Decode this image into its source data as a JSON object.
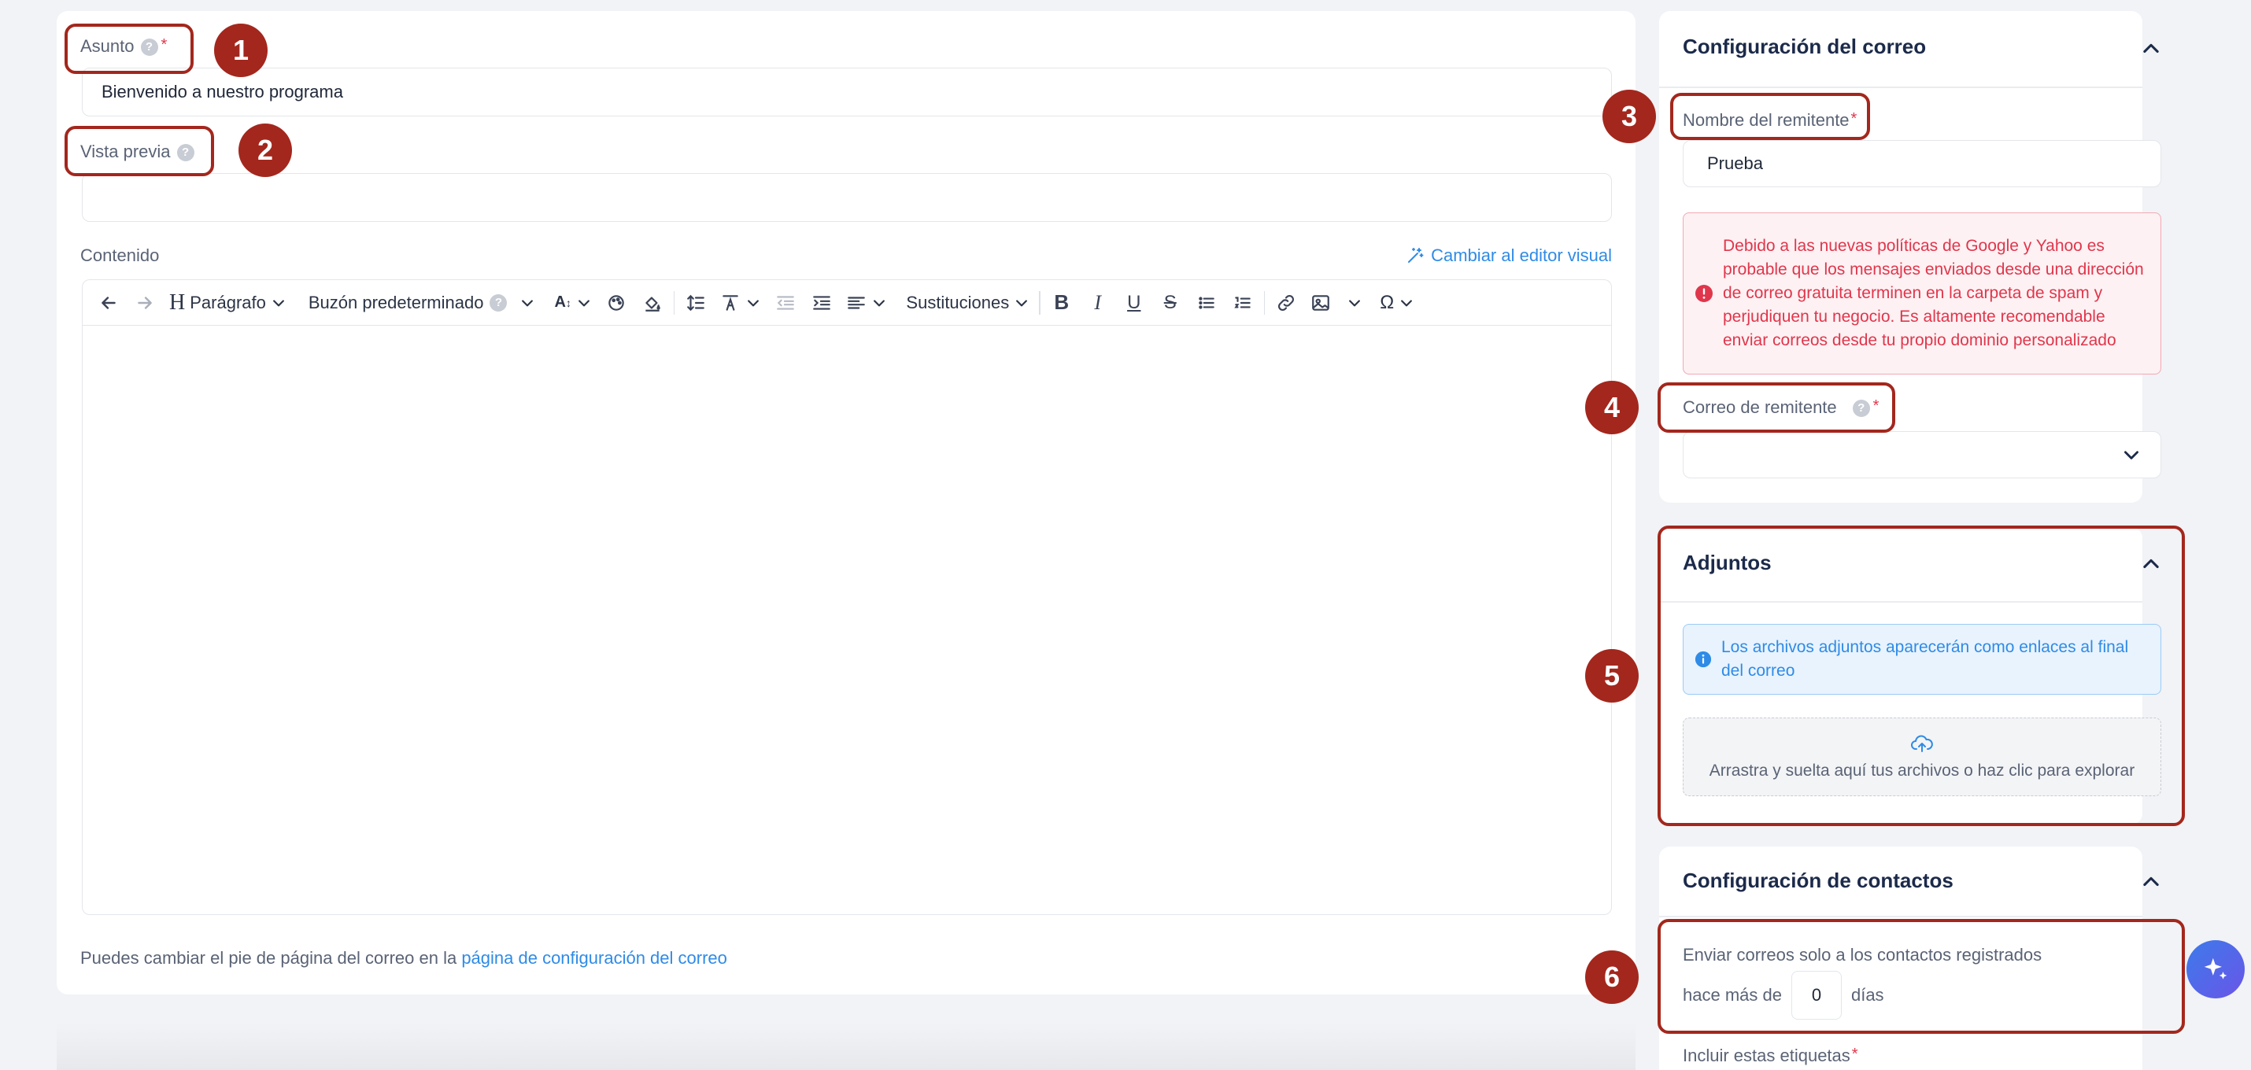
{
  "left": {
    "subject_label": "Asunto",
    "subject_value": "Bienvenido a nuestro programa",
    "preview_label": "Vista previa",
    "preview_value": "",
    "content_label": "Contenido",
    "switch_editor": "Cambiar al editor visual",
    "toolbar": {
      "paragraph": "Parágrafo",
      "mailbox": "Buzón predeterminado",
      "substitutions": "Sustituciones"
    },
    "footer_text": "Puedes cambiar el pie de página del correo en la ",
    "footer_link": "página de configuración del correo"
  },
  "email_config": {
    "title": "Configuración del correo",
    "sender_name_label": "Nombre del remitente",
    "sender_name_value": "Prueba",
    "warning": "Debido a las nuevas políticas de Google y Yahoo es probable que los mensajes enviados desde una dirección de correo gratuita terminen en la carpeta de spam y perjudiquen tu negocio. Es altamente recomendable enviar correos desde tu propio dominio personalizado",
    "sender_email_label": "Correo de remitente",
    "sender_email_value": ""
  },
  "attachments": {
    "title": "Adjuntos",
    "info": "Los archivos adjuntos aparecerán como enlaces al final del correo",
    "dropzone": "Arrastra y suelta aquí tus archivos o haz clic para explorar"
  },
  "contacts_config": {
    "title": "Configuración de contactos",
    "line1": "Enviar correos solo a los contactos registrados",
    "prefix": "hace más de",
    "days_value": "0",
    "suffix": "días",
    "tags_label": "Incluir estas etiquetas"
  },
  "badges": [
    "1",
    "2",
    "3",
    "4",
    "5",
    "6"
  ],
  "colors": {
    "accent": "#2f8be6",
    "annotation": "#a3271d",
    "warning_text": "#e0364c",
    "warning_bg": "#fdf1f3",
    "info_bg": "#e8f3fd"
  },
  "icons": {
    "help": "?",
    "ai_button": "sparkle-icon"
  }
}
